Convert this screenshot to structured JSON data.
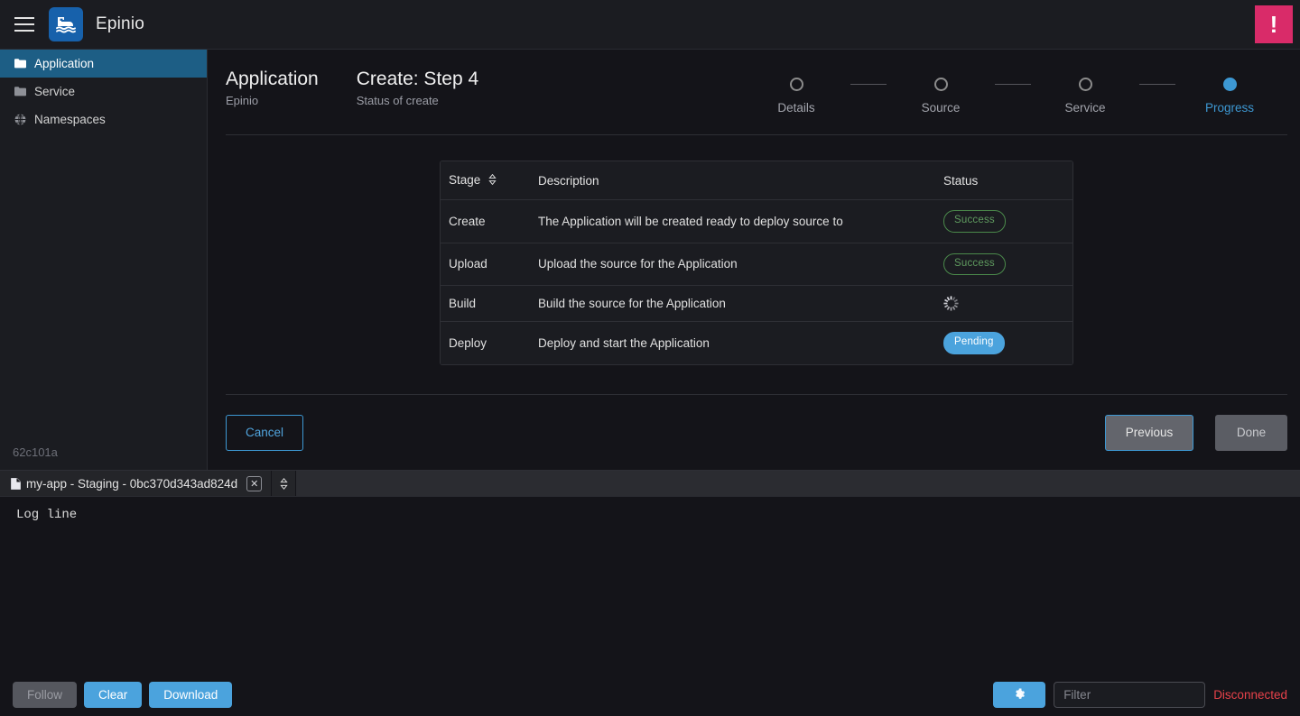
{
  "header": {
    "menu_icon": "hamburger-menu-icon",
    "logo_icon": "epinio-ship-logo",
    "brand": "Epinio",
    "alert_icon": "alert-exclamation-icon",
    "alert_symbol": "!",
    "alert_color": "#d92b69"
  },
  "sidebar": {
    "items": [
      {
        "label": "Application",
        "icon": "folder-icon",
        "active": true
      },
      {
        "label": "Service",
        "icon": "folder-icon",
        "active": false
      },
      {
        "label": "Namespaces",
        "icon": "globe-icon",
        "active": false
      }
    ],
    "version": "62c101a"
  },
  "page": {
    "title": "Application",
    "subtitle": "Epinio",
    "step_title": "Create: Step 4",
    "step_subtitle": "Status of create"
  },
  "stepper": {
    "steps": [
      {
        "label": "Details",
        "active": false
      },
      {
        "label": "Source",
        "active": false
      },
      {
        "label": "Service",
        "active": false
      },
      {
        "label": "Progress",
        "active": true
      }
    ],
    "active_color": "#3d98d3"
  },
  "table": {
    "columns": [
      "Stage",
      "Description",
      "Status"
    ],
    "sort_icon": "sort-chevron-icon",
    "rows": [
      {
        "stage": "Create",
        "description": "The Application will be created ready to deploy source to",
        "status": "Success",
        "status_type": "success"
      },
      {
        "stage": "Upload",
        "description": "Upload the source for the Application",
        "status": "Success",
        "status_type": "success"
      },
      {
        "stage": "Build",
        "description": "Build the source for the Application",
        "status": "",
        "status_type": "spinner"
      },
      {
        "stage": "Deploy",
        "description": "Deploy and start the Application",
        "status": "Pending",
        "status_type": "pending"
      }
    ],
    "colors": {
      "success": "#5f9b5f",
      "pending": "#4ba3dd"
    }
  },
  "footer": {
    "cancel_label": "Cancel",
    "previous_label": "Previous",
    "done_label": "Done"
  },
  "logs": {
    "tab": {
      "icon": "file-icon",
      "label": "my-app - Staging - 0bc370d343ad824d",
      "close_icon": "close-icon",
      "close_symbol": "✕"
    },
    "more_icon": "chevron-up-down-icon",
    "lines": [
      "Log line"
    ]
  },
  "toolbar": {
    "follow_label": "Follow",
    "clear_label": "Clear",
    "download_label": "Download",
    "gear_icon": "gear-icon",
    "filter_placeholder": "Filter",
    "filter_value": "",
    "connection_status": "Disconnected",
    "connection_color": "#e8424a"
  }
}
